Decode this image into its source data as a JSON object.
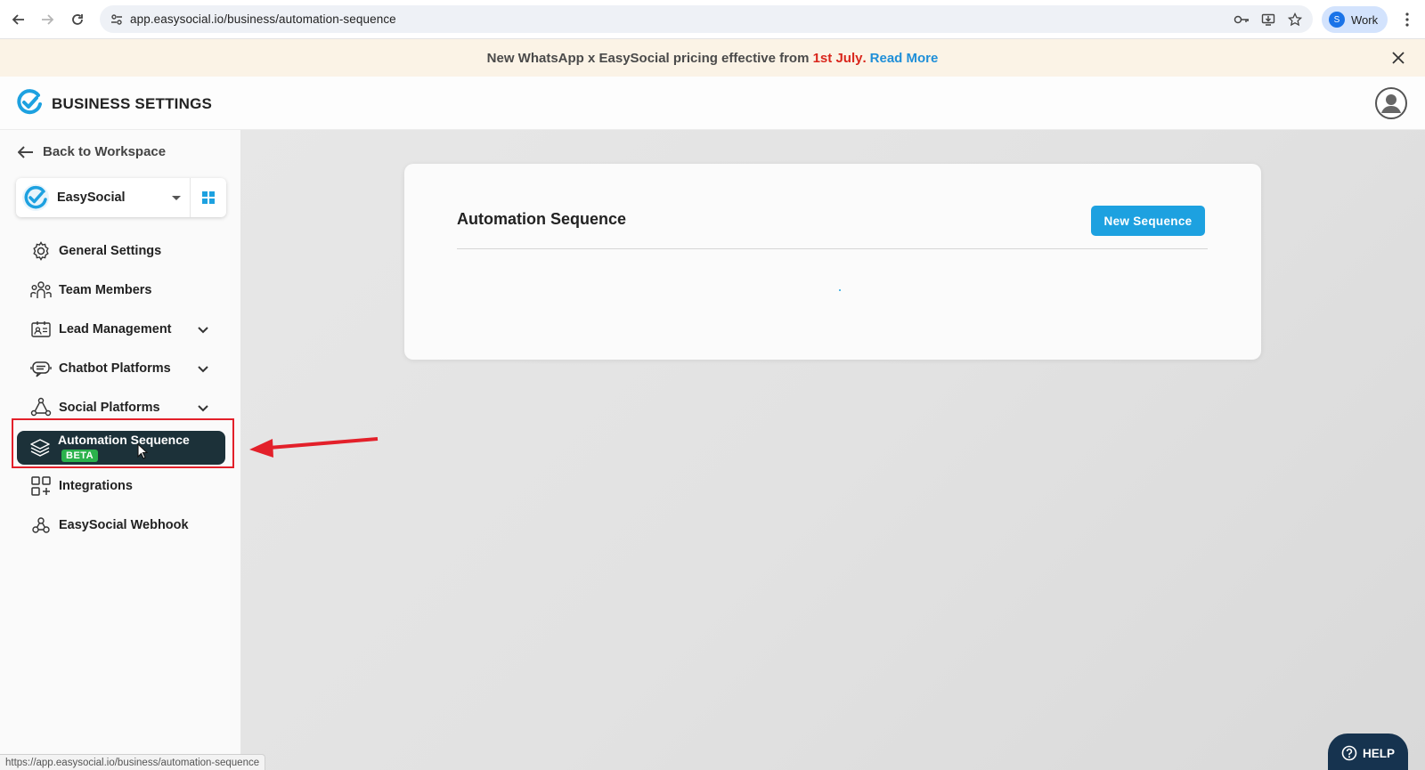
{
  "browser": {
    "url": "app.easysocial.io/business/automation-sequence",
    "profile_initial": "S",
    "profile_label": "Work"
  },
  "banner": {
    "text_prefix": "New WhatsApp x EasySocial pricing effective from",
    "highlight": "1st July",
    "period": ".",
    "link": "Read More"
  },
  "header": {
    "title": "BUSINESS SETTINGS"
  },
  "sidebar": {
    "back_label": "Back to Workspace",
    "workspace_name": "EasySocial",
    "items": [
      {
        "label": "General Settings",
        "icon": "gear-icon",
        "chevron": false
      },
      {
        "label": "Team Members",
        "icon": "team-icon",
        "chevron": false
      },
      {
        "label": "Lead Management",
        "icon": "contact-card-icon",
        "chevron": true
      },
      {
        "label": "Chatbot Platforms",
        "icon": "chatbot-icon",
        "chevron": true
      },
      {
        "label": "Social Platforms",
        "icon": "share-network-icon",
        "chevron": true
      },
      {
        "label": "Automation Sequence",
        "icon": "layers-icon",
        "badge": "BETA",
        "active": true
      },
      {
        "label": "Integrations",
        "icon": "integrations-grid-icon",
        "chevron": false
      },
      {
        "label": "EasySocial Webhook",
        "icon": "webhook-icon",
        "chevron": false
      }
    ]
  },
  "main": {
    "card_title": "Automation Sequence",
    "new_button": "New Sequence"
  },
  "status_bar": {
    "url": "https://app.easysocial.io/business/automation-sequence"
  },
  "help": {
    "label": "HELP"
  },
  "colors": {
    "accent": "#1da1e0",
    "active_bg": "#1c3139",
    "badge": "#2bb24c",
    "annotation": "#e3202a"
  }
}
